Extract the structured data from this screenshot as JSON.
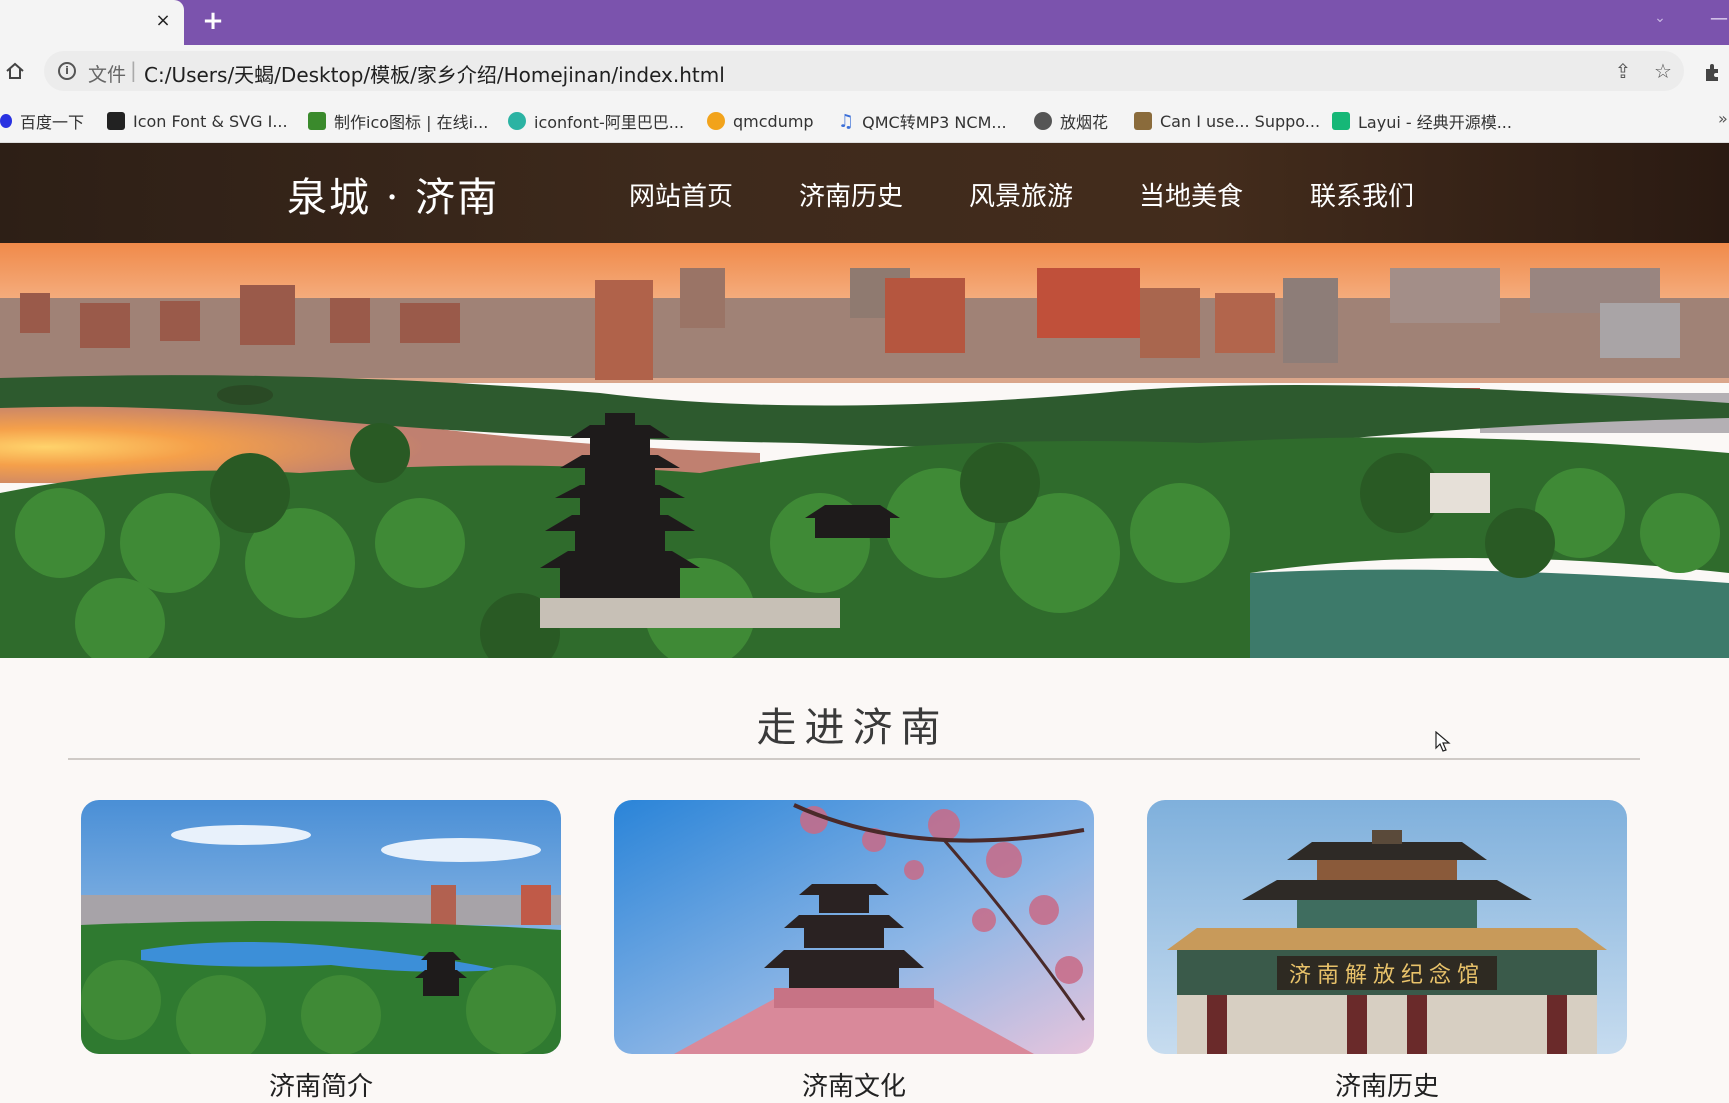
{
  "browser": {
    "tab_close": "×",
    "new_tab": "+",
    "file_label": "文件",
    "url": "C:/Users/天蝎/Desktop/模板/家乡介绍/Homejinan/index.html",
    "bookmarks": [
      {
        "label": "百度一下",
        "icon": "baidu-icon",
        "color": "#2932e1"
      },
      {
        "label": "Icon Font & SVG I...",
        "icon": "iconfont-svg-icon",
        "color": "#222222"
      },
      {
        "label": "制作ico图标 | 在线i...",
        "icon": "bitbug-icon",
        "color": "#3a8a2c"
      },
      {
        "label": "iconfont-阿里巴巴...",
        "icon": "iconfont-alibaba-icon",
        "color": "#2bb3a3"
      },
      {
        "label": "qmcdump",
        "icon": "qmcdump-icon",
        "color": "#f2a31b"
      },
      {
        "label": "QMC转MP3 NCM...",
        "icon": "music-note-icon",
        "color": "#3b6fd8"
      },
      {
        "label": "放烟花",
        "icon": "globe-icon",
        "color": "#555555"
      },
      {
        "label": "Can I use... Suppo...",
        "icon": "caniuse-icon",
        "color": "#8a6b3b"
      },
      {
        "label": "Layui - 经典开源模...",
        "icon": "layui-icon",
        "color": "#16b777"
      }
    ],
    "more": "»"
  },
  "site": {
    "logo": "泉城 · 济南",
    "nav": [
      "网站首页",
      "济南历史",
      "风景旅游",
      "当地美食",
      "联系我们"
    ]
  },
  "section": {
    "title": "走进济南",
    "cards": [
      {
        "caption": "济南简介"
      },
      {
        "caption": "济南文化"
      },
      {
        "caption": "济南历史",
        "sign_text": "济南解放纪念馆"
      }
    ]
  },
  "colors": {
    "tabbar": "#7b53ad",
    "header": "#3e2a1c",
    "page_bg": "#fbf8f6"
  }
}
